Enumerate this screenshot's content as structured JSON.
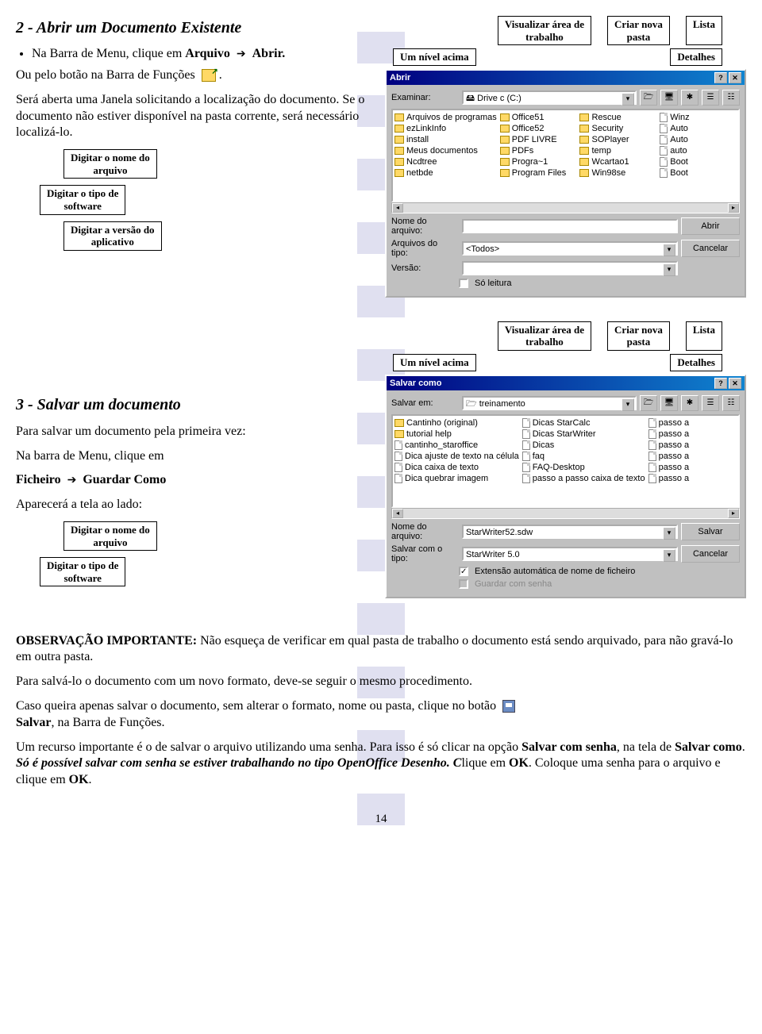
{
  "section2": {
    "heading": "2 - Abrir um Documento Existente",
    "bullet_prefix": "Na Barra de Menu, clique em ",
    "bullet_bold1": "Arquivo",
    "bullet_bold2": "Abrir.",
    "line2_a": "Ou pelo botão na Barra de  Funções ",
    "line2_b": ".",
    "para": "Será aberta uma Janela solicitando a localização do documento. Se o documento não estiver disponível na pasta corrente, será necessário localizá-lo.",
    "c_file": "Digitar o nome do\narquivo",
    "c_type": "Digitar o tipo de\nsoftware",
    "c_ver": "Digitar a versão do\naplicativo"
  },
  "section3": {
    "heading": "3 - Salvar um documento",
    "p1": "Para salvar um documento pela primeira vez:",
    "p2": "Na barra de Menu, clique em",
    "p3a": "Ficheiro",
    "p3b": "Guardar Como",
    "p4": "Aparecerá a tela ao lado:",
    "c_file": "Digitar o nome do\narquivo",
    "c_type": "Digitar o tipo de\nsoftware"
  },
  "callouts": {
    "visualizar": "Visualizar área de\ntrabalho",
    "umnivel": "Um nível acima",
    "criar": "Criar nova\npasta",
    "lista": "Lista",
    "detalhes": "Detalhes"
  },
  "obs": {
    "head": "OBSERVAÇÃO IMPORTANTE:",
    "p1": " Não  esqueça de verificar em qual pasta de trabalho o documento está sendo arquivado, para não gravá-lo em outra pasta.",
    "p2": "Para salvá-lo o documento com um novo formato, deve-se seguir o mesmo procedimento.",
    "p3a": "Caso queira apenas salvar o documento, sem alterar o formato, nome ou pasta, clique  no botão ",
    "p3b": "Salvar",
    "p3c": ", na Barra de Funções.",
    "p4a": "Um recurso importante é o de salvar o arquivo utilizando uma senha. Para isso é só clicar na opção ",
    "p4b": "Salvar com senha",
    "p4c": ", na tela de ",
    "p4d": "Salvar como",
    "p4e": ". ",
    "p4f": "Só é possível salvar com senha se estiver trabalhando no tipo OpenOffice Desenho. C",
    "p4g": "lique em ",
    "p4h": "OK",
    "p4i": ". Coloque uma senha para o arquivo e  clique em ",
    "p4j": "OK",
    "p4k": "."
  },
  "dlg_open": {
    "title": "Abrir",
    "examinar_label": "Examinar:",
    "examinar_value": "Drive c (C:)",
    "col1": [
      "Arquivos de programas",
      "ezLinkInfo",
      "install",
      "Meus documentos",
      "Ncdtree",
      "netbde"
    ],
    "col2": [
      "Office51",
      "Office52",
      "PDF LIVRE",
      "PDFs",
      "Progra~1",
      "Program Files"
    ],
    "col3": [
      "Rescue",
      "Security",
      "SOPlayer",
      "temp",
      "Wcartao1",
      "Win98se"
    ],
    "col4": [
      "Winz",
      "Auto",
      "Auto",
      "auto",
      "Boot",
      "Boot"
    ],
    "nome_label": "Nome do\narquivo:",
    "nome_value": "",
    "tipo_label": "Arquivos do\ntipo:",
    "tipo_value": "<Todos>",
    "versao_label": "Versão:",
    "btn_abrir": "Abrir",
    "btn_cancelar": "Cancelar",
    "so_leitura": "Só leitura"
  },
  "dlg_save": {
    "title": "Salvar como",
    "salvar_em_label": "Salvar em:",
    "salvar_em_value": "treinamento",
    "col1": [
      "Cantinho (original)",
      "tutorial help",
      "cantinho_staroffice",
      "Dica ajuste de texto na célula",
      "Dica caixa de texto",
      "Dica quebrar imagem"
    ],
    "col2": [
      "Dicas StarCalc",
      "Dicas StarWriter",
      "Dicas",
      "faq",
      "FAQ-Desktop",
      "passo a passo caixa de texto"
    ],
    "col3": [
      "passo a",
      "passo a",
      "passo a",
      "passo a",
      "passo a",
      "passo a"
    ],
    "nome_label": "Nome do\narquivo:",
    "nome_value": "StarWriter52.sdw",
    "tipo_label": "Salvar com o\ntipo:",
    "tipo_value": "StarWriter 5.0",
    "btn_salvar": "Salvar",
    "btn_cancelar": "Cancelar",
    "ext_auto": "Extensão automática de nome de ficheiro",
    "guardar_senha": "Guardar com senha"
  },
  "page_number": "14"
}
